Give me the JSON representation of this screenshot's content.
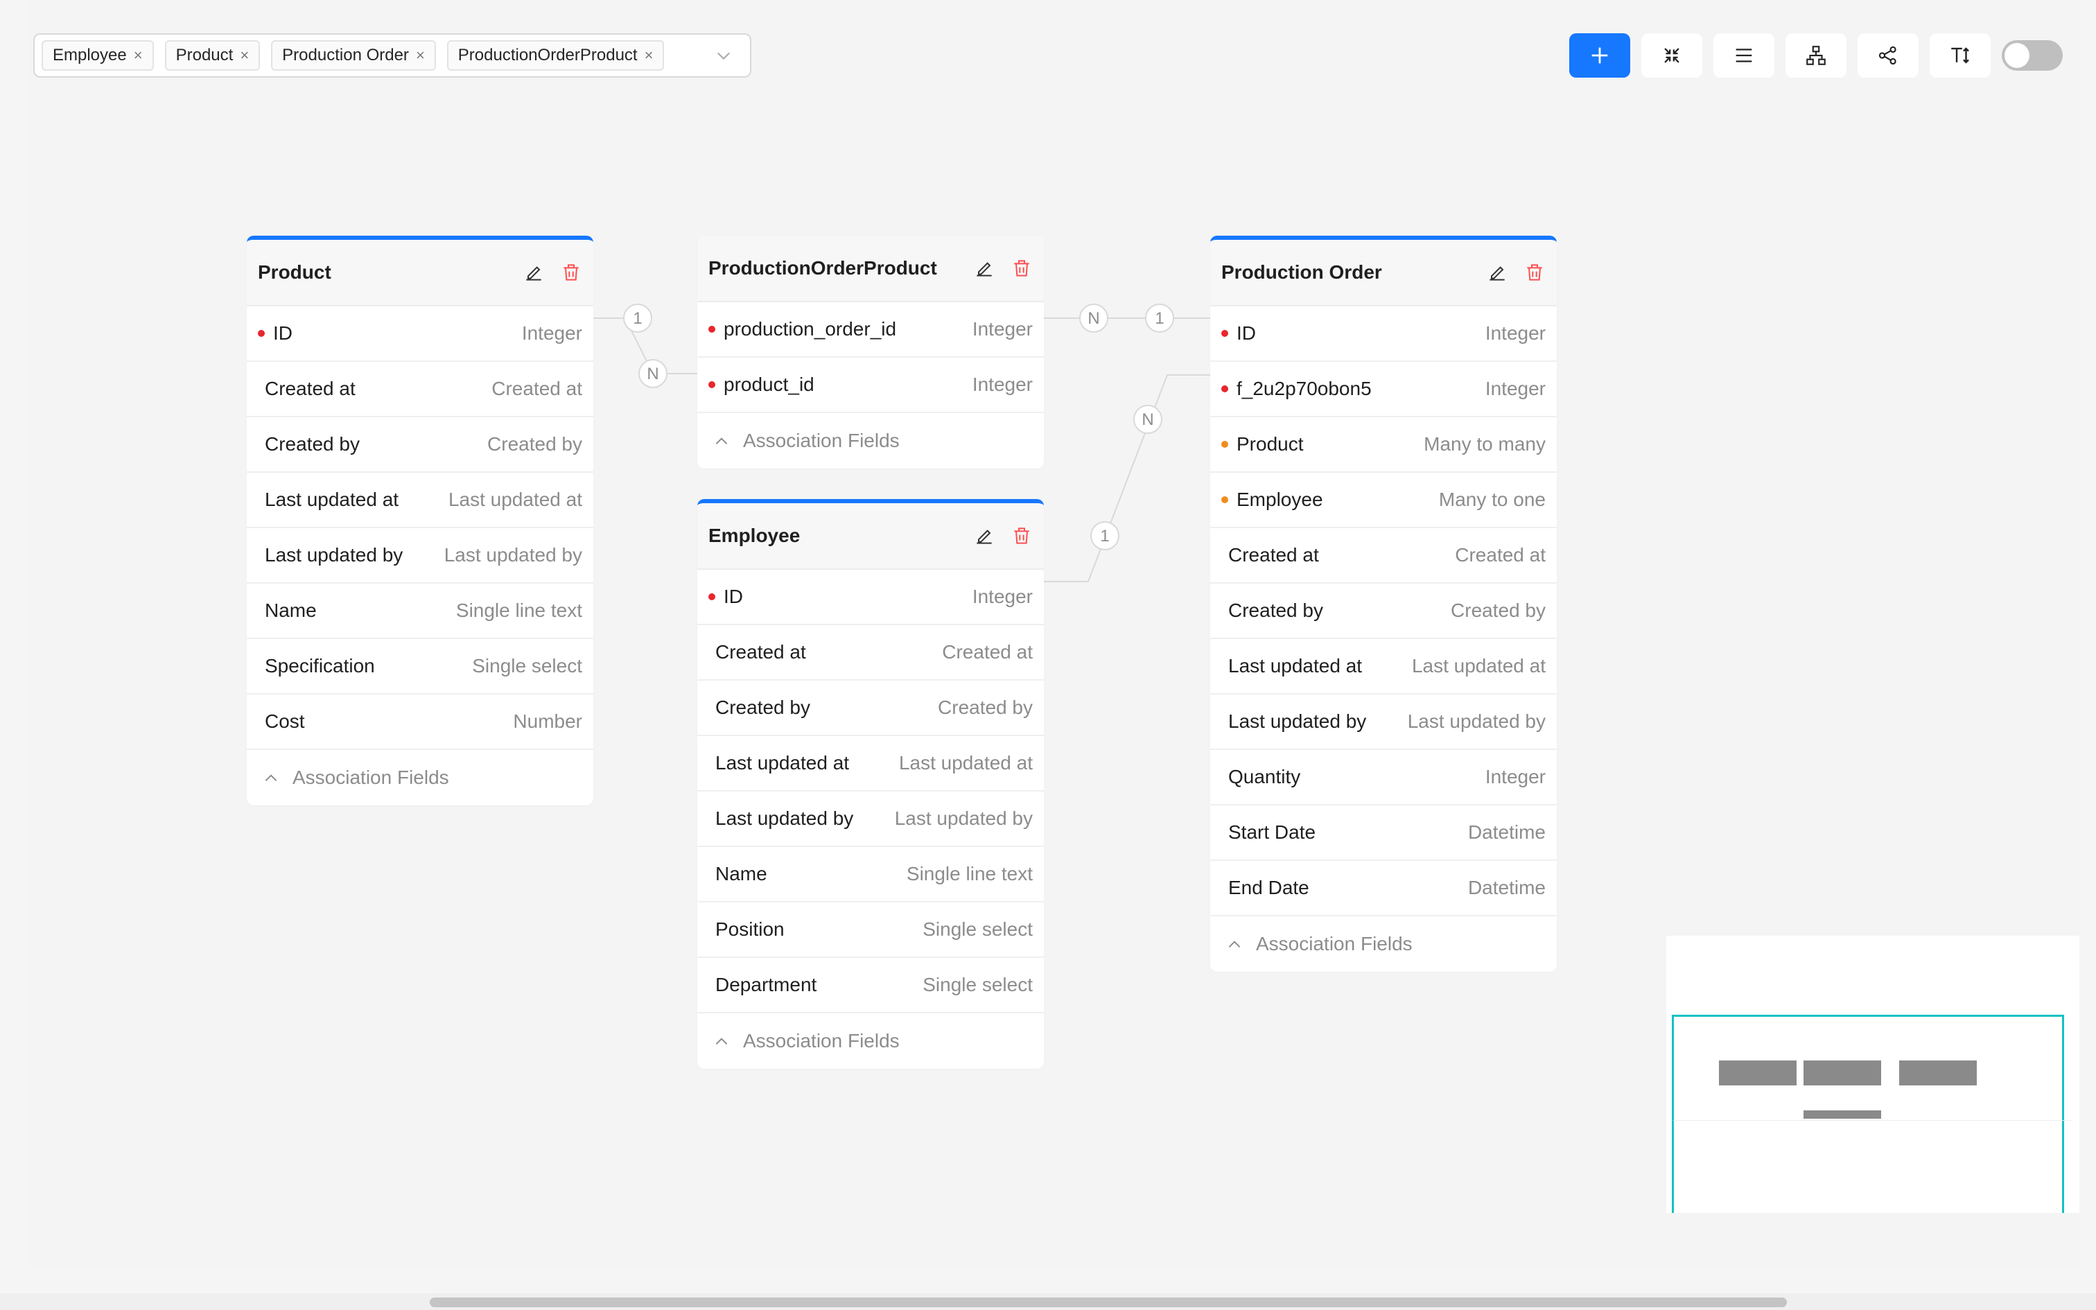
{
  "filter": {
    "tags": [
      "Employee",
      "Product",
      "Production Order",
      "ProductionOrderProduct"
    ],
    "remove_glyph": "×"
  },
  "toolbar": {
    "icons": [
      "plus-icon",
      "collapse-icon",
      "menu-icon",
      "hierarchy-icon",
      "share-icon",
      "text-size-icon"
    ],
    "primary_color": "#1677ff",
    "toggle_on": false
  },
  "tables": {
    "product": {
      "title": "Product",
      "fields": [
        {
          "name": "ID",
          "type": "Integer",
          "marker": "red"
        },
        {
          "name": "Created at",
          "type": "Created at",
          "marker": "none"
        },
        {
          "name": "Created by",
          "type": "Created by",
          "marker": "none"
        },
        {
          "name": "Last updated at",
          "type": "Last updated at",
          "marker": "none"
        },
        {
          "name": "Last updated by",
          "type": "Last updated by",
          "marker": "none"
        },
        {
          "name": "Name",
          "type": "Single line text",
          "marker": "none"
        },
        {
          "name": "Specification",
          "type": "Single select",
          "marker": "none"
        },
        {
          "name": "Cost",
          "type": "Number",
          "marker": "none"
        }
      ],
      "association_label": "Association Fields"
    },
    "production_order_product": {
      "title": "ProductionOrderProduct",
      "fields": [
        {
          "name": "production_order_id",
          "type": "Integer",
          "marker": "red"
        },
        {
          "name": "product_id",
          "type": "Integer",
          "marker": "red"
        }
      ],
      "association_label": "Association Fields"
    },
    "employee": {
      "title": "Employee",
      "fields": [
        {
          "name": "ID",
          "type": "Integer",
          "marker": "red"
        },
        {
          "name": "Created at",
          "type": "Created at",
          "marker": "none"
        },
        {
          "name": "Created by",
          "type": "Created by",
          "marker": "none"
        },
        {
          "name": "Last updated at",
          "type": "Last updated at",
          "marker": "none"
        },
        {
          "name": "Last updated by",
          "type": "Last updated by",
          "marker": "none"
        },
        {
          "name": "Name",
          "type": "Single line text",
          "marker": "none"
        },
        {
          "name": "Position",
          "type": "Single select",
          "marker": "none"
        },
        {
          "name": "Department",
          "type": "Single select",
          "marker": "none"
        }
      ],
      "association_label": "Association Fields"
    },
    "production_order": {
      "title": "Production Order",
      "fields": [
        {
          "name": "ID",
          "type": "Integer",
          "marker": "red"
        },
        {
          "name": "f_2u2p70obon5",
          "type": "Integer",
          "marker": "red"
        },
        {
          "name": "Product",
          "type": "Many to many",
          "marker": "orange"
        },
        {
          "name": "Employee",
          "type": "Many to one",
          "marker": "orange"
        },
        {
          "name": "Created at",
          "type": "Created at",
          "marker": "none"
        },
        {
          "name": "Created by",
          "type": "Created by",
          "marker": "none"
        },
        {
          "name": "Last updated at",
          "type": "Last updated at",
          "marker": "none"
        },
        {
          "name": "Last updated by",
          "type": "Last updated by",
          "marker": "none"
        },
        {
          "name": "Quantity",
          "type": "Integer",
          "marker": "none"
        },
        {
          "name": "Start Date",
          "type": "Datetime",
          "marker": "none"
        },
        {
          "name": "End Date",
          "type": "Datetime",
          "marker": "none"
        }
      ],
      "association_label": "Association Fields"
    }
  },
  "relations": {
    "product_to_pop": {
      "from": "1",
      "to": "N"
    },
    "pop_to_order": {
      "from": "N",
      "to": "1"
    },
    "employee_to_order": {
      "from": "1",
      "to": "N"
    }
  }
}
